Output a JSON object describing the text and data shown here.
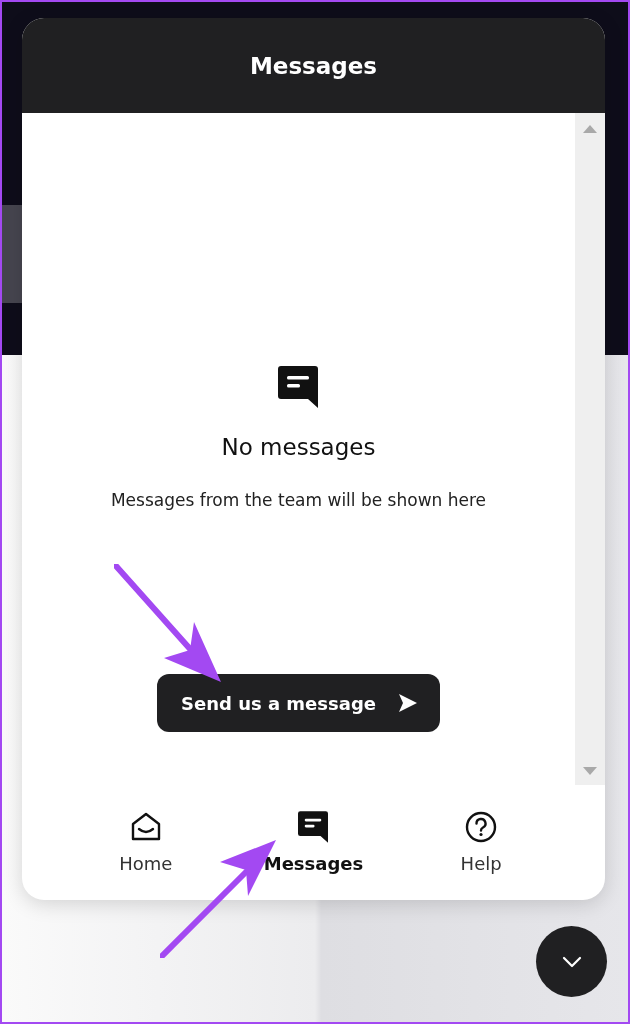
{
  "panel": {
    "title": "Messages"
  },
  "empty_state": {
    "heading": "No messages",
    "text": "Messages from the team will be shown here"
  },
  "send_button": {
    "label": "Send us a message"
  },
  "nav": [
    {
      "kind": "home",
      "label": "Home",
      "selected": false
    },
    {
      "kind": "messages",
      "label": "Messages",
      "selected": true
    },
    {
      "kind": "help",
      "label": "Help",
      "selected": false
    }
  ]
}
